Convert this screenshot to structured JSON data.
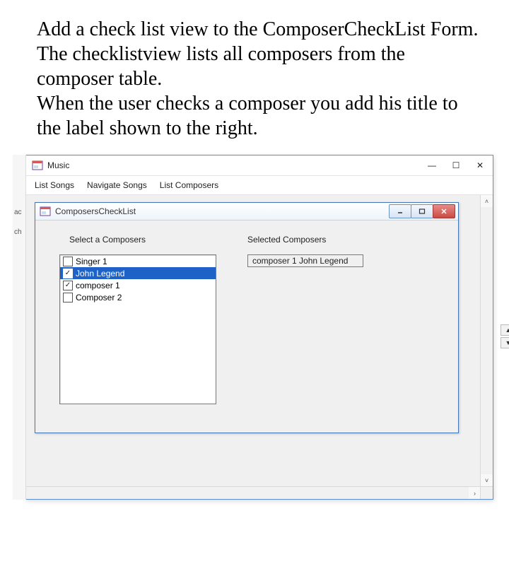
{
  "instructions": {
    "line1": "Add a check list view to the ComposerCheckList Form.",
    "line2": "The checklistview lists all composers from the composer table.",
    "line3": "When the user checks a composer you add his title to the label shown to the right."
  },
  "parent_window": {
    "title": "Music",
    "menus": [
      "List Songs",
      "Navigate Songs",
      "List Composers"
    ]
  },
  "clipped_text": {
    "a": "ac",
    "b": "ch"
  },
  "child_window": {
    "title": "ComposersCheckList",
    "left_label": "Select a Composers",
    "right_label": "Selected Composers",
    "result_text": "composer 1 John Legend",
    "items": [
      {
        "label": "Singer 1",
        "checked": false,
        "selected": false
      },
      {
        "label": "John Legend",
        "checked": true,
        "selected": true
      },
      {
        "label": "composer 1",
        "checked": true,
        "selected": false
      },
      {
        "label": "Composer 2",
        "checked": false,
        "selected": false
      }
    ]
  }
}
